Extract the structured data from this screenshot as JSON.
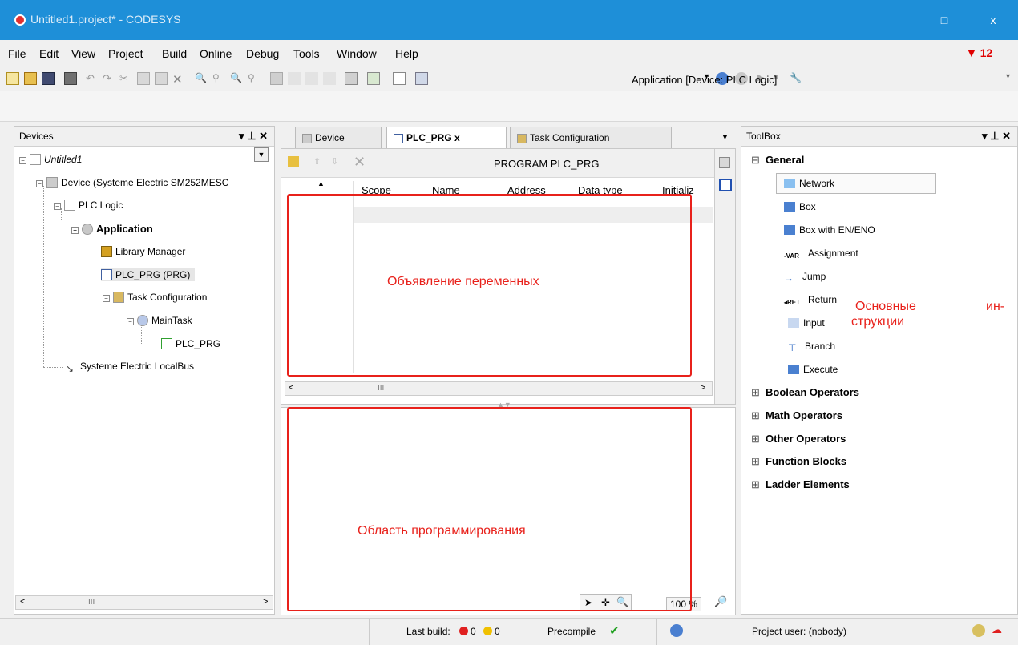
{
  "window": {
    "title": "Untitled1.project* - CODESYS",
    "controls": [
      "_",
      "□",
      "x"
    ]
  },
  "menu": [
    "File",
    "Edit",
    "View",
    "Project",
    "Build",
    "Online",
    "Debug",
    "Tools",
    "Window",
    "Help"
  ],
  "error_count": "12",
  "toolbar": {
    "application_selector": "Application [Device: PLC Logic]"
  },
  "devices": {
    "title": "Devices",
    "controls": "▾  ⊥  ✕",
    "nodes": [
      "Untitled1",
      "Device (Systeme Electric SM252MESC",
      "PLC Logic",
      "Application",
      "Library Manager",
      "PLC_PRG (PRG)",
      "Task Configuration",
      "MainTask",
      "PLC_PRG",
      "Systeme Electric LocalBus"
    ],
    "scroll_label": "III"
  },
  "editor": {
    "tabs": [
      "Device",
      "PLC_PRG",
      "Task Configuration"
    ],
    "tab_close": "x",
    "header": "PROGRAM PLC_PRG",
    "columns": [
      "Scope",
      "Name",
      "Address",
      "Data type",
      "Initializ"
    ],
    "scroll_label": "III",
    "zoom": "100 %"
  },
  "toolbox": {
    "title": "ToolBox",
    "controls": "▾  ⊥  ✕",
    "general": "General",
    "items": [
      "Network",
      "Box",
      "Box with EN/ENO",
      "Assignment",
      "Jump",
      "Return",
      "Input",
      "Branch",
      "Execute"
    ],
    "categories": [
      "Boolean Operators",
      "Math Operators",
      "Other Operators",
      "Function Blocks",
      "Ladder Elements"
    ]
  },
  "annotations": {
    "variables": "Объявление переменных",
    "programming": "Область программирования",
    "instructions_1": "Основные",
    "instructions_2": "ин-",
    "instructions_3": "струкции"
  },
  "status": {
    "last_build": "Last build:",
    "errors": "0",
    "warnings": "0",
    "precompile": "Precompile",
    "user": "Project user: (nobody)"
  }
}
